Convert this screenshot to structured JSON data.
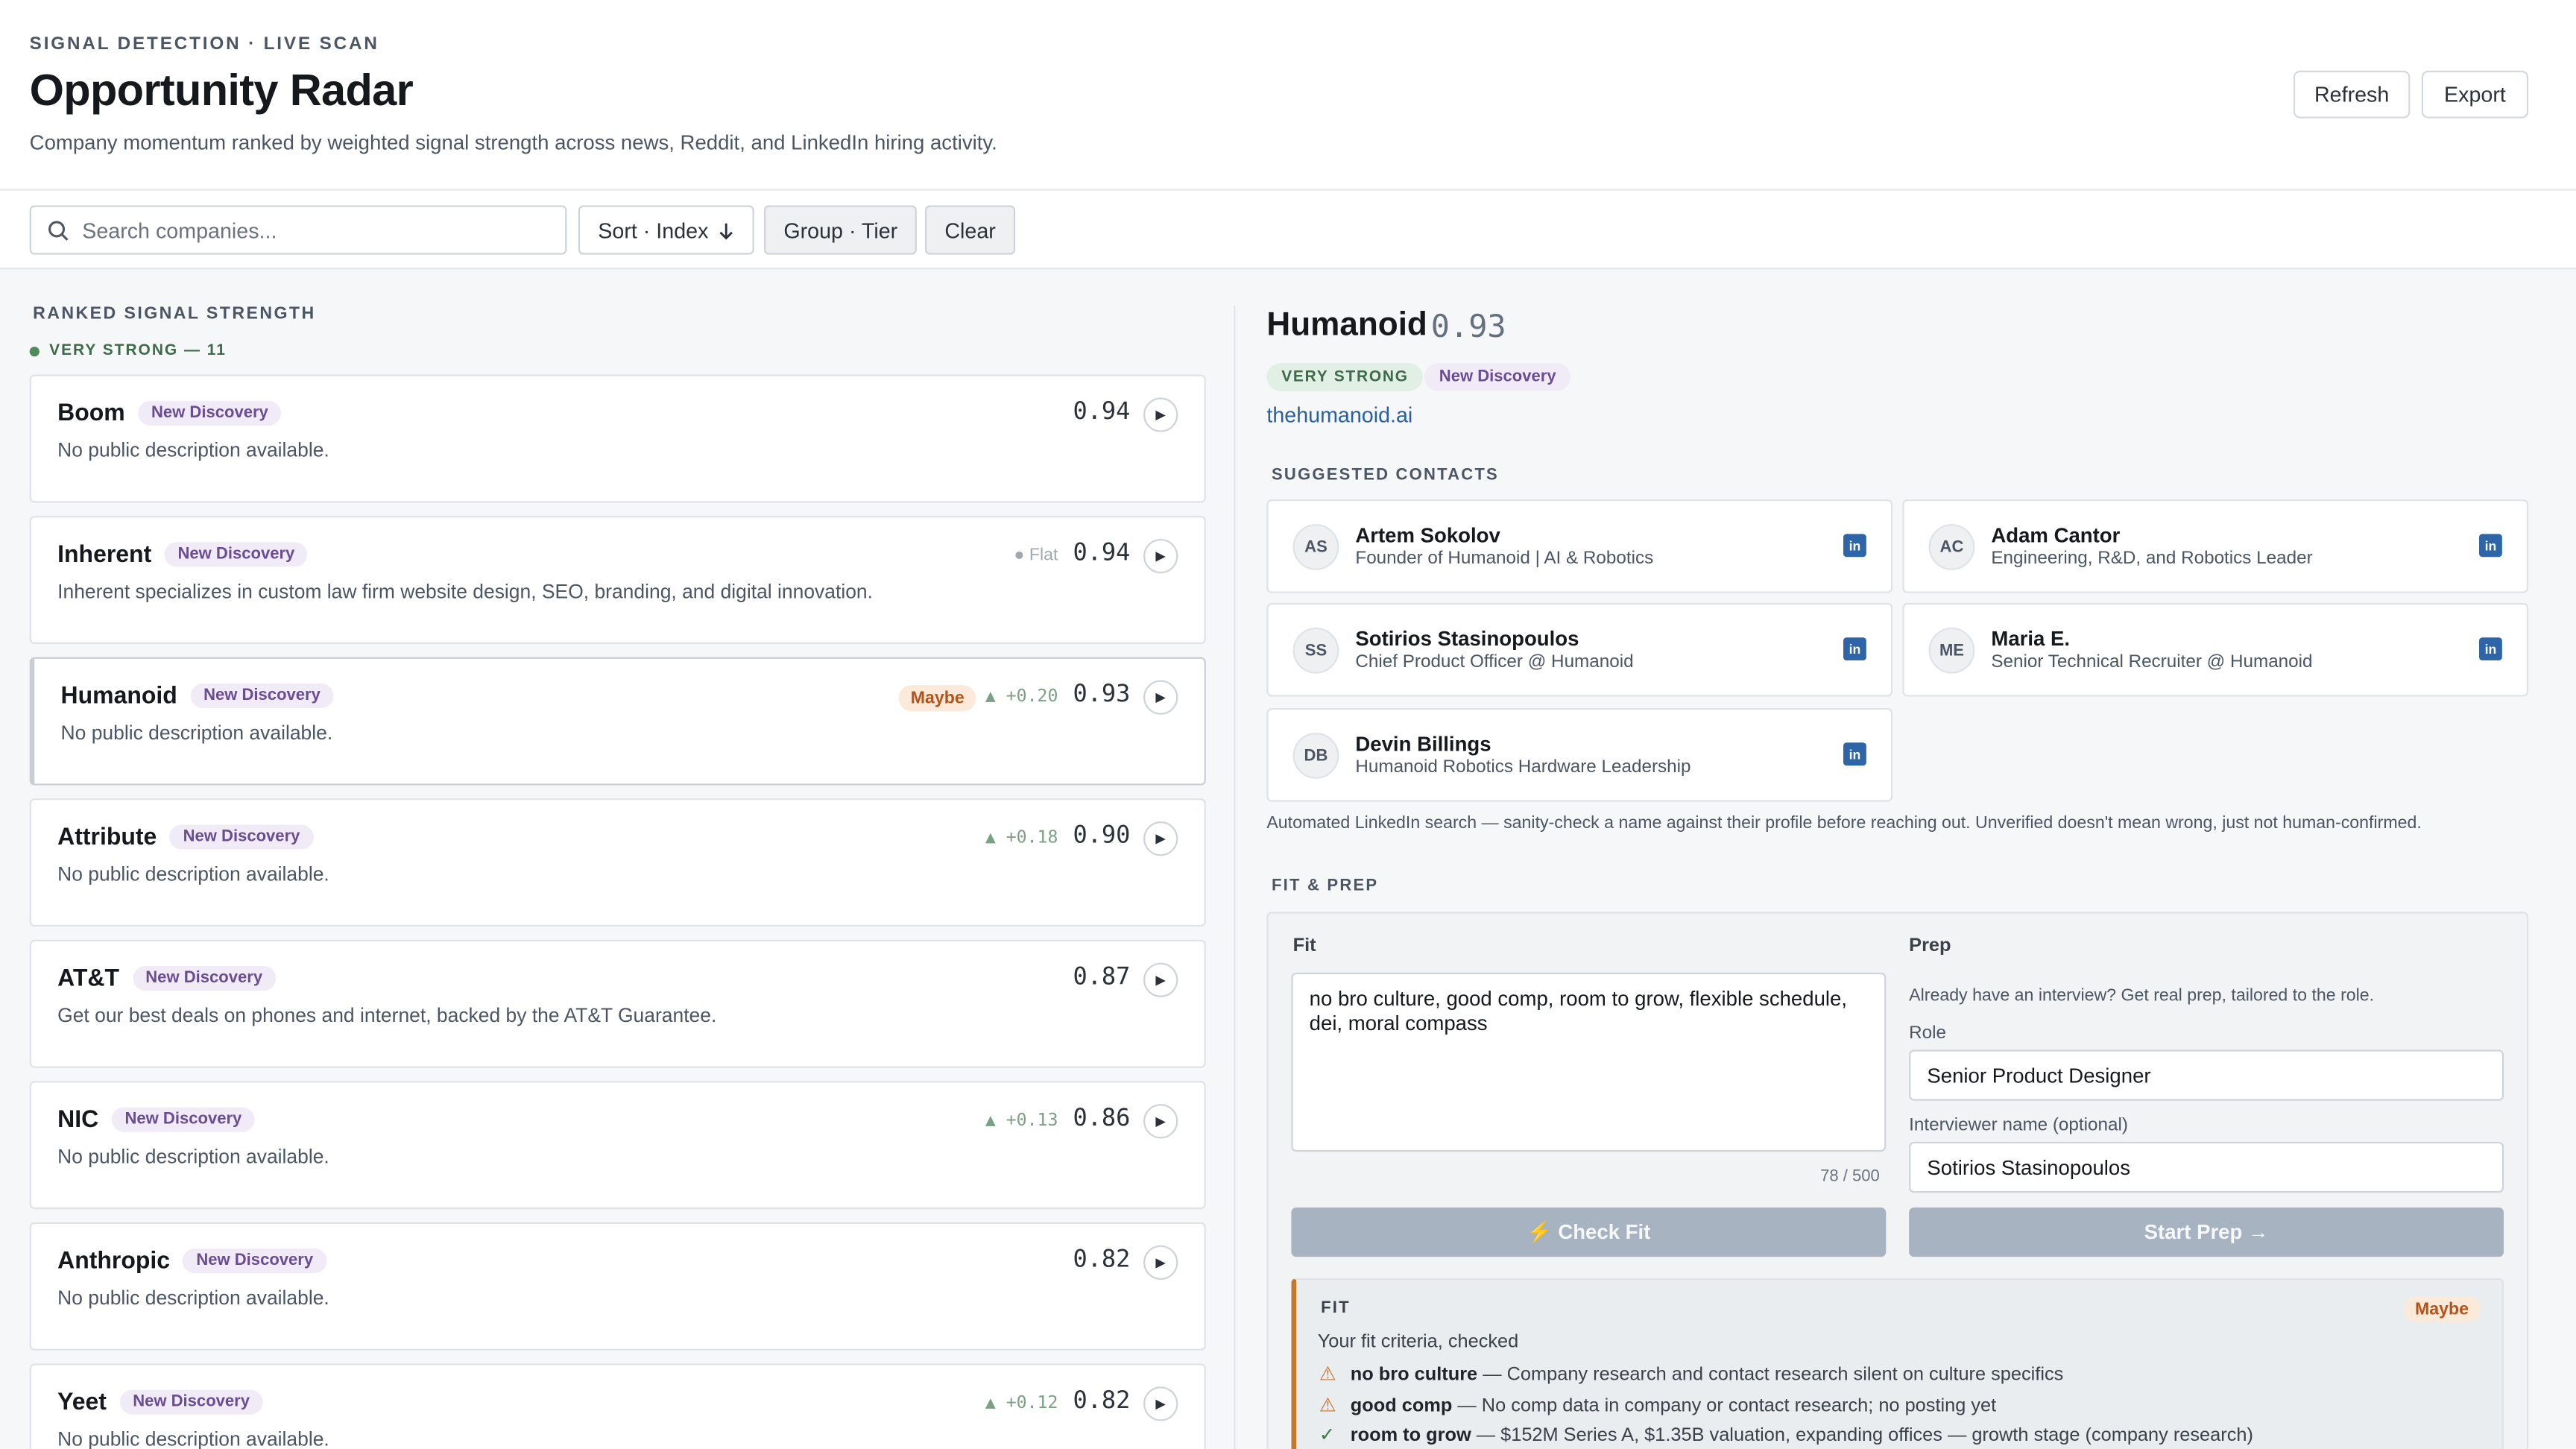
{
  "header": {
    "eyebrow": "SIGNAL DETECTION · LIVE SCAN",
    "title": "Opportunity Radar",
    "subtitle": "Company momentum ranked by weighted signal strength across news, Reddit, and LinkedIn hiring activity.",
    "refresh_label": "Refresh",
    "export_label": "Export"
  },
  "toolbar": {
    "search_placeholder": "Search companies...",
    "sort_label": "Sort · Index",
    "group_label": "Group · Tier",
    "clear_label": "Clear"
  },
  "list": {
    "heading": "RANKED SIGNAL STRENGTH",
    "tier_label": "VERY STRONG — 11",
    "items": [
      {
        "name": "Boom",
        "badge": "New Discovery",
        "desc": "No public description available.",
        "score": "0.94",
        "delta": "",
        "status": ""
      },
      {
        "name": "Inherent",
        "badge": "New Discovery",
        "desc": "Inherent specializes in custom law firm website design, SEO, branding, and digital innovation.",
        "score": "0.94",
        "delta": "",
        "status": "Flat"
      },
      {
        "name": "Humanoid",
        "badge": "New Discovery",
        "desc": "No public description available.",
        "score": "0.93",
        "delta": "▲ +0.20",
        "status": "",
        "fit": "Maybe"
      },
      {
        "name": "Attribute",
        "badge": "New Discovery",
        "desc": "No public description available.",
        "score": "0.90",
        "delta": "▲ +0.18",
        "status": ""
      },
      {
        "name": "AT&T",
        "badge": "New Discovery",
        "desc": "Get our best deals on phones and internet, backed by the AT&T Guarantee.",
        "score": "0.87",
        "delta": "",
        "status": ""
      },
      {
        "name": "NIC",
        "badge": "New Discovery",
        "desc": "No public description available.",
        "score": "0.86",
        "delta": "▲ +0.13",
        "status": ""
      },
      {
        "name": "Anthropic",
        "badge": "New Discovery",
        "desc": "No public description available.",
        "score": "0.82",
        "delta": "",
        "status": ""
      },
      {
        "name": "Yeet",
        "badge": "New Discovery",
        "desc": "No public description available.",
        "score": "0.82",
        "delta": "▲ +0.12",
        "status": ""
      }
    ]
  },
  "detail": {
    "name": "Humanoid",
    "score": "0.93",
    "tier": "VERY STRONG",
    "badge": "New Discovery",
    "url": "thehumanoid.ai",
    "contacts_heading": "SUGGESTED CONTACTS",
    "contacts": [
      {
        "initials": "AS",
        "name": "Artem Sokolov",
        "role": "Founder of Humanoid | AI & Robotics"
      },
      {
        "initials": "AC",
        "name": "Adam Cantor",
        "role": "Engineering, R&D, and Robotics Leader"
      },
      {
        "initials": "SS",
        "name": "Sotirios Stasinopoulos",
        "role": "Chief Product Officer @ Humanoid"
      },
      {
        "initials": "ME",
        "name": "Maria E.",
        "role": "Senior Technical Recruiter @ Humanoid"
      },
      {
        "initials": "DB",
        "name": "Devin Billings",
        "role": "Humanoid Robotics Hardware Leadership"
      }
    ],
    "linkedin_icon_text": "in",
    "contacts_note": "Automated LinkedIn search — sanity-check a name against their profile before reaching out. Unverified doesn't mean wrong, just not human-confirmed.",
    "fitprep_heading": "FIT & PREP",
    "fit_label": "Fit",
    "fit_text": "no bro culture, good comp, room to grow, flexible schedule, dei, moral compass",
    "fit_counter": "78 / 500",
    "check_fit_label": "⚡ Check Fit",
    "prep_label": "Prep",
    "prep_help": "Already have an interview? Get real prep, tailored to the role.",
    "role_label": "Role",
    "role_value": "Senior Product Designer",
    "interviewer_label": "Interviewer name (optional)",
    "interviewer_value": "Sotirios Stasinopoulos",
    "start_prep_label": "Start Prep →",
    "result": {
      "label": "FIT",
      "verdict": "Maybe",
      "intro": "Your fit criteria, checked",
      "criteria": [
        {
          "icon": "⚠",
          "kind": "warn",
          "term": "no bro culture",
          "text": " — Company research and contact research silent on culture specifics"
        },
        {
          "icon": "⚠",
          "kind": "warn",
          "term": "good comp",
          "text": " — No comp data in company or contact research; no posting yet"
        },
        {
          "icon": "✓",
          "kind": "ok",
          "term": "room to grow",
          "text": " — $152M Series A, $1.35B valuation, expanding offices — growth stage (company research)"
        }
      ]
    }
  },
  "colors": {
    "accent_link": "#2b5f9e",
    "tier_green": "#3d6b4a",
    "badge_purple": "#6a4c93",
    "maybe_orange": "#b4531c",
    "button_disabled": "#a7b3c1"
  }
}
